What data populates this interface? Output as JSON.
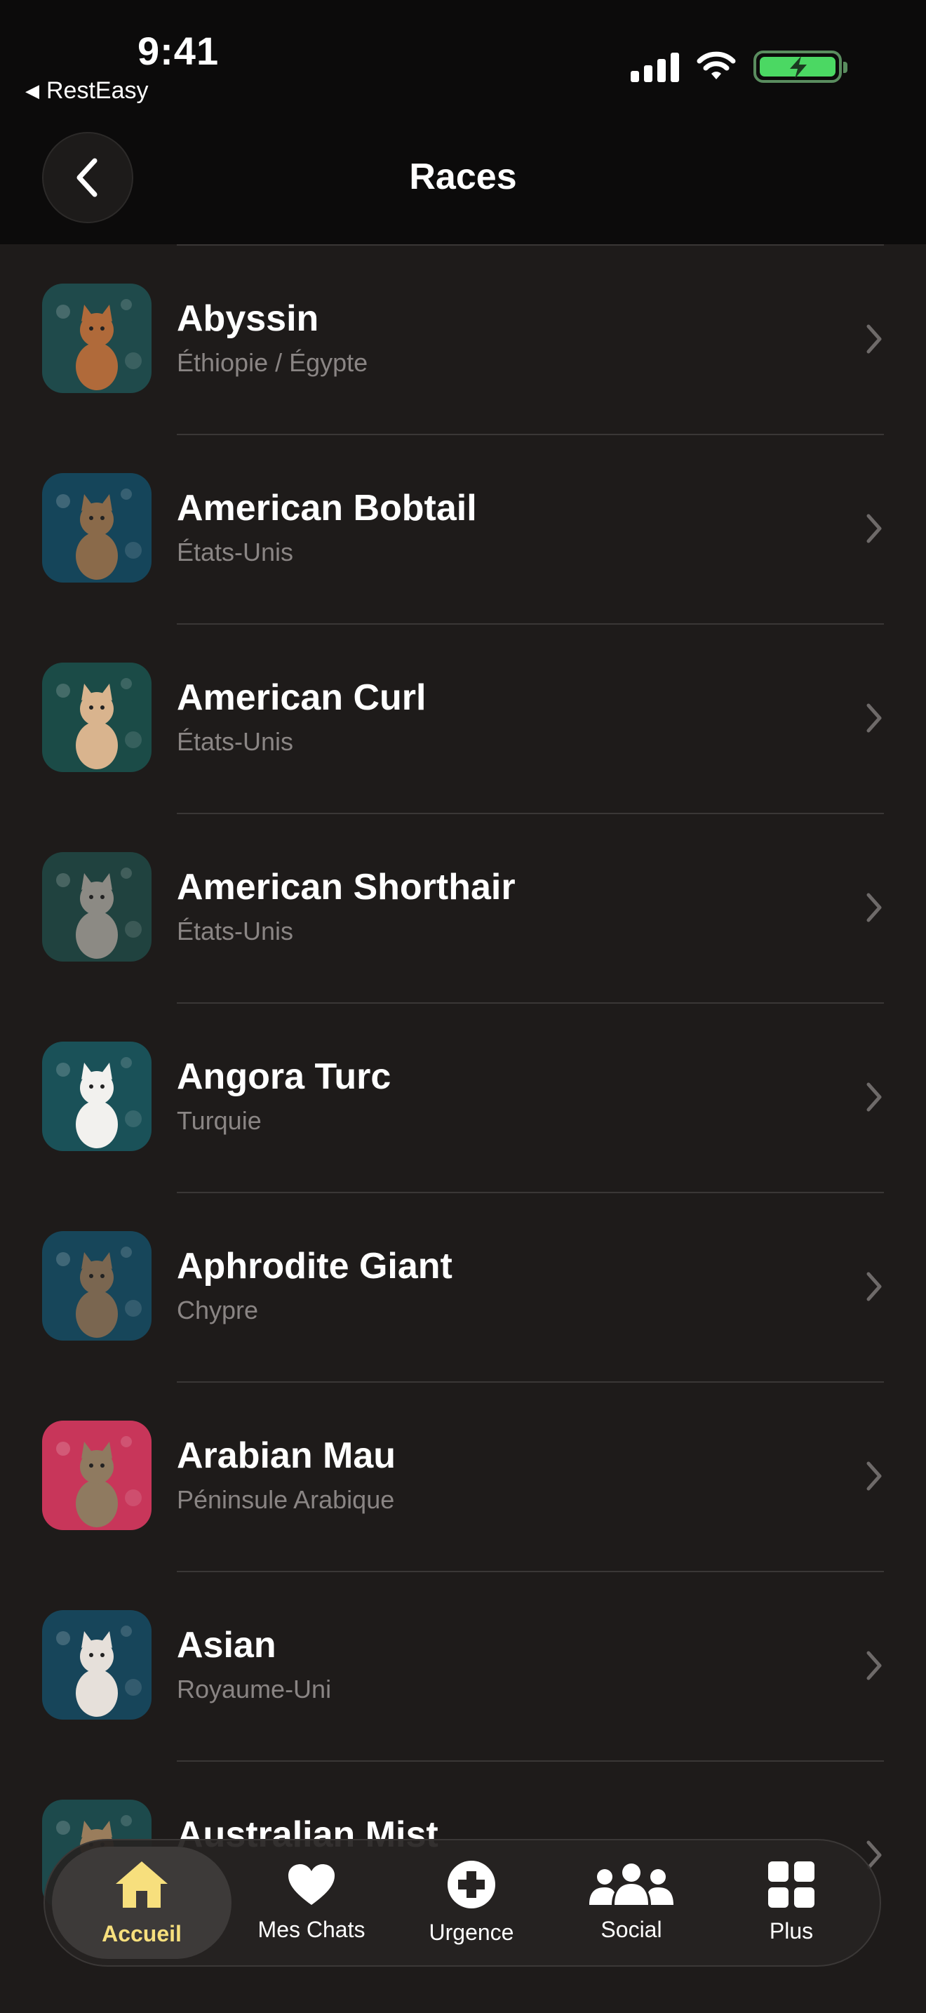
{
  "status_bar": {
    "time": "9:41",
    "back_app": "RestEasy"
  },
  "header": {
    "title": "Races"
  },
  "breeds": [
    {
      "name": "Abyssin",
      "origin": "Éthiopie / Égypte",
      "bg": "#1f4a4b",
      "cat": "#b06a3a"
    },
    {
      "name": "American Bobtail",
      "origin": "États-Unis",
      "bg": "#15455a",
      "cat": "#8a6a4a"
    },
    {
      "name": "American Curl",
      "origin": "États-Unis",
      "bg": "#1b4b47",
      "cat": "#d9b48e"
    },
    {
      "name": "American Shorthair",
      "origin": "États-Unis",
      "bg": "#20423f",
      "cat": "#8c8a84"
    },
    {
      "name": "Angora Turc",
      "origin": "Turquie",
      "bg": "#1a5158",
      "cat": "#f2f1ee"
    },
    {
      "name": "Aphrodite Giant",
      "origin": "Chypre",
      "bg": "#17465a",
      "cat": "#7a6650"
    },
    {
      "name": "Arabian Mau",
      "origin": "Péninsule Arabique",
      "bg": "#c8365a",
      "cat": "#8f7a60"
    },
    {
      "name": "Asian",
      "origin": "Royaume-Uni",
      "bg": "#17455a",
      "cat": "#e6e0da"
    },
    {
      "name": "Australian Mist",
      "origin": "",
      "bg": "#1d4a4c",
      "cat": "#9a7d5c"
    }
  ],
  "tabs": [
    {
      "label": "Accueil",
      "icon": "home-icon",
      "active": true
    },
    {
      "label": "Mes Chats",
      "icon": "heart-icon",
      "active": false
    },
    {
      "label": "Urgence",
      "icon": "cross-icon",
      "active": false
    },
    {
      "label": "Social",
      "icon": "people-icon",
      "active": false
    },
    {
      "label": "Plus",
      "icon": "grid-icon",
      "active": false
    }
  ],
  "colors": {
    "accent": "#f7df7d",
    "background": "#1e1b1a",
    "battery": "#4bd863"
  }
}
